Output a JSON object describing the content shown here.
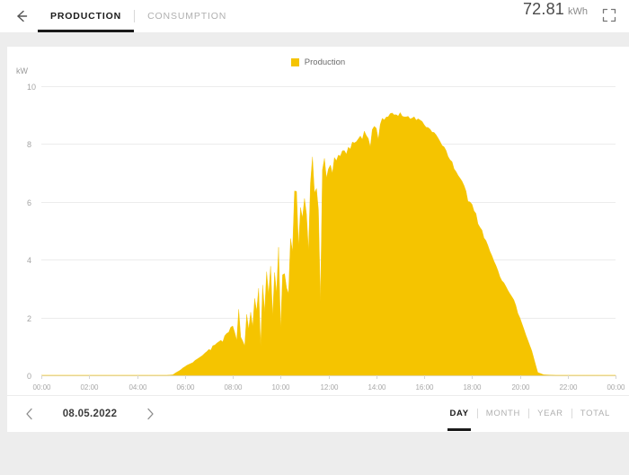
{
  "header": {
    "back_icon": "arrow-left-icon",
    "tabs": [
      {
        "label": "PRODUCTION",
        "active": true
      },
      {
        "label": "CONSUMPTION",
        "active": false
      }
    ],
    "total_value": "72.81",
    "total_unit": "kWh",
    "fullscreen_icon": "fullscreen-icon"
  },
  "chart": {
    "legend_label": "Production",
    "legend_color": "#f5c400",
    "y_axis_unit": "kW"
  },
  "footer": {
    "prev_icon": "chevron-left-icon",
    "next_icon": "chevron-right-icon",
    "date": "08.05.2022",
    "periods": [
      {
        "label": "DAY",
        "active": true
      },
      {
        "label": "MONTH",
        "active": false
      },
      {
        "label": "YEAR",
        "active": false
      },
      {
        "label": "TOTAL",
        "active": false
      }
    ]
  },
  "chart_data": {
    "type": "area",
    "title": "",
    "xlabel": "",
    "ylabel": "kW",
    "ylim": [
      0,
      10
    ],
    "xlim": [
      0,
      24
    ],
    "grid": true,
    "legend_position": "top-center",
    "series": [
      {
        "name": "Production",
        "color": "#f5c400",
        "unit": "kW",
        "total": 72.81,
        "total_unit": "kWh"
      }
    ],
    "y_ticks": [
      0,
      2,
      4,
      6,
      8,
      10
    ],
    "y_tick_labels": [
      "0",
      "2",
      "4",
      "6",
      "8",
      "10"
    ],
    "x_ticks": [
      0,
      2,
      4,
      6,
      8,
      10,
      12,
      14,
      16,
      18,
      20,
      22,
      24
    ],
    "x_tick_labels": [
      "00:00",
      "02:00",
      "04:00",
      "06:00",
      "08:00",
      "10:00",
      "12:00",
      "14:00",
      "16:00",
      "18:00",
      "20:00",
      "22:00",
      "00:00"
    ],
    "x_unit": "hour",
    "sample_interval_minutes": 5,
    "x": [
      0,
      0.5,
      1,
      1.5,
      2,
      2.5,
      3,
      3.5,
      4,
      4.5,
      5,
      5.25,
      5.5,
      5.583,
      5.667,
      5.75,
      5.833,
      5.917,
      6,
      6.083,
      6.167,
      6.25,
      6.333,
      6.417,
      6.5,
      6.583,
      6.667,
      6.75,
      6.833,
      6.917,
      7,
      7.083,
      7.167,
      7.25,
      7.333,
      7.417,
      7.5,
      7.583,
      7.667,
      7.75,
      7.833,
      7.917,
      8,
      8.083,
      8.167,
      8.25,
      8.333,
      8.417,
      8.5,
      8.583,
      8.667,
      8.75,
      8.833,
      8.917,
      9,
      9.083,
      9.167,
      9.25,
      9.333,
      9.417,
      9.5,
      9.583,
      9.667,
      9.75,
      9.833,
      9.917,
      10,
      10.083,
      10.167,
      10.25,
      10.333,
      10.417,
      10.5,
      10.583,
      10.667,
      10.75,
      10.833,
      10.917,
      11,
      11.083,
      11.167,
      11.25,
      11.333,
      11.417,
      11.5,
      11.583,
      11.667,
      11.75,
      11.833,
      11.917,
      12,
      12.25,
      12.5,
      12.75,
      13,
      13.25,
      13.5,
      13.75,
      14,
      14.25,
      14.5,
      14.75,
      15,
      15.25,
      15.5,
      15.75,
      16,
      16.25,
      16.5,
      16.75,
      17,
      17.25,
      17.5,
      17.75,
      18,
      18.25,
      18.5,
      18.75,
      19,
      19.25,
      19.5,
      19.75,
      20,
      20.25,
      20.5,
      20.667,
      20.75,
      21,
      21.5,
      22,
      22.5,
      23,
      23.5,
      24
    ],
    "y": [
      0,
      0,
      0,
      0,
      0,
      0,
      0,
      0,
      0,
      0,
      0,
      0,
      0.02,
      0.07,
      0.12,
      0.16,
      0.2,
      0.25,
      0.3,
      0.34,
      0.38,
      0.42,
      0.46,
      0.5,
      0.55,
      0.6,
      0.65,
      0.7,
      0.76,
      0.82,
      0.88,
      0.95,
      1.0,
      1.06,
      1.1,
      1.16,
      1.22,
      1.28,
      1.34,
      1.42,
      1.5,
      1.58,
      1.6,
      1.95,
      1.4,
      2.25,
      1.5,
      2.35,
      1.55,
      2.2,
      1.75,
      2.45,
      1.7,
      2.5,
      2.0,
      2.85,
      2.1,
      3.1,
      2.3,
      3.3,
      2.55,
      3.55,
      2.6,
      3.9,
      2.9,
      4.2,
      3.15,
      4.55,
      3.4,
      4.85,
      3.7,
      5.2,
      4.0,
      5.55,
      5.95,
      4.6,
      6.2,
      5.0,
      6.4,
      5.4,
      6.5,
      5.75,
      6.65,
      6.1,
      6.85,
      6.4,
      7.0,
      6.7,
      7.1,
      6.95,
      7.2,
      7.45,
      7.6,
      7.75,
      7.95,
      8.15,
      8.3,
      8.45,
      8.62,
      8.75,
      8.88,
      8.95,
      9.0,
      8.98,
      8.9,
      8.82,
      8.7,
      8.5,
      8.25,
      7.95,
      7.6,
      7.2,
      6.8,
      6.35,
      5.9,
      5.4,
      4.85,
      4.3,
      3.8,
      3.35,
      2.95,
      2.6,
      2.0,
      1.4,
      0.85,
      0.35,
      0.1,
      0.02,
      0,
      0,
      0,
      0,
      0,
      0
    ]
  }
}
